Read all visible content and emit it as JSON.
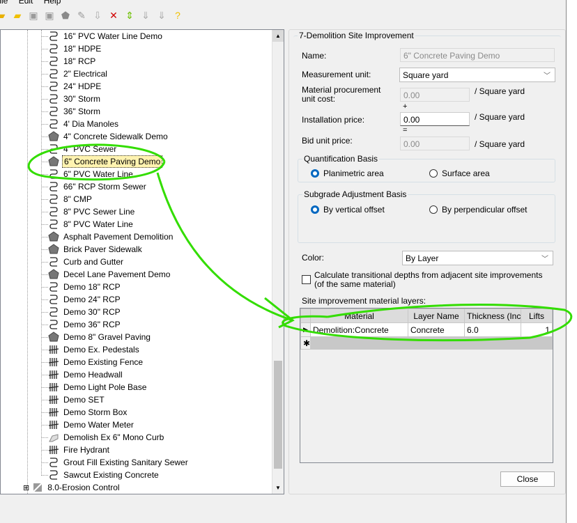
{
  "menu": [
    "File",
    "Edit",
    "Help"
  ],
  "toolbar": [
    {
      "icon": "new-folder-icon",
      "glyph": "▰",
      "color": "#e8b000"
    },
    {
      "icon": "open-folder-icon",
      "glyph": "▰",
      "color": "#f0c000"
    },
    {
      "icon": "save-icon",
      "glyph": "▣",
      "color": "#9a9a9a"
    },
    {
      "icon": "save-all-icon",
      "glyph": "▣",
      "color": "#9a9a9a"
    },
    {
      "icon": "add-shape-icon",
      "glyph": "⬟",
      "color": "#8a8a8a"
    },
    {
      "icon": "add-line-icon",
      "glyph": "✎",
      "color": "#9a9a9a"
    },
    {
      "icon": "import-icon",
      "glyph": "⇩",
      "color": "#aaa"
    },
    {
      "icon": "delete-icon",
      "glyph": "✕",
      "color": "#d00000"
    },
    {
      "icon": "expand-icon",
      "glyph": "⇕",
      "color": "#6cc000"
    },
    {
      "icon": "move-down-icon",
      "glyph": "⇓",
      "color": "#aaa"
    },
    {
      "icon": "move-down-2-icon",
      "glyph": "⇓",
      "color": "#aaa"
    },
    {
      "icon": "help-icon",
      "glyph": "?",
      "color": "#f0c000"
    }
  ],
  "tree": {
    "items": [
      {
        "label": "16\" PVC Water Line Demo",
        "icon": "pipe"
      },
      {
        "label": "18\" HDPE",
        "icon": "pipe"
      },
      {
        "label": "18\" RCP",
        "icon": "pipe"
      },
      {
        "label": "2\" Electrical",
        "icon": "pipe"
      },
      {
        "label": "24\" HDPE",
        "icon": "pipe"
      },
      {
        "label": "30\" Storm",
        "icon": "pipe"
      },
      {
        "label": "36\" Storm",
        "icon": "pipe"
      },
      {
        "label": "4' Dia Manoles",
        "icon": "pipe"
      },
      {
        "label": "4\" Concrete Sidewalk Demo",
        "icon": "area"
      },
      {
        "label": "4\" PVC Sewer",
        "icon": "pipe"
      },
      {
        "label": "6\" Concrete Paving Demo",
        "icon": "area",
        "selected": true
      },
      {
        "label": "6\" PVC Water Line",
        "icon": "pipe"
      },
      {
        "label": "66\" RCP Storm Sewer",
        "icon": "pipe"
      },
      {
        "label": "8\" CMP",
        "icon": "pipe"
      },
      {
        "label": "8\" PVC Sewer Line",
        "icon": "pipe"
      },
      {
        "label": "8\" PVC Water Line",
        "icon": "pipe"
      },
      {
        "label": "Asphalt Pavement Demolition",
        "icon": "area"
      },
      {
        "label": "Brick Paver Sidewalk",
        "icon": "area"
      },
      {
        "label": "Curb and Gutter",
        "icon": "pipe"
      },
      {
        "label": "Decel Lane Pavement Demo",
        "icon": "area"
      },
      {
        "label": "Demo 18\" RCP",
        "icon": "pipe"
      },
      {
        "label": "Demo 24\" RCP",
        "icon": "pipe"
      },
      {
        "label": "Demo 30\" RCP",
        "icon": "pipe"
      },
      {
        "label": "Demo 36\" RCP",
        "icon": "pipe"
      },
      {
        "label": "Demo 8\" Gravel Paving",
        "icon": "area"
      },
      {
        "label": "Demo Ex. Pedestals",
        "icon": "point"
      },
      {
        "label": "Demo Existing Fence",
        "icon": "point"
      },
      {
        "label": "Demo Headwall",
        "icon": "point"
      },
      {
        "label": "Demo Light Pole Base",
        "icon": "point"
      },
      {
        "label": "Demo SET",
        "icon": "point"
      },
      {
        "label": "Demo Storm Box",
        "icon": "point"
      },
      {
        "label": "Demo Water Meter",
        "icon": "point"
      },
      {
        "label": "Demolish Ex 6\" Mono Curb",
        "icon": "curb"
      },
      {
        "label": "Fire Hydrant",
        "icon": "point"
      },
      {
        "label": "Grout Fill Existing Sanitary Sewer",
        "icon": "pipe"
      },
      {
        "label": "Sawcut Existing Concrete",
        "icon": "pipe"
      }
    ],
    "folder": {
      "label": "8.0-Erosion Control",
      "expander": "⊞"
    }
  },
  "panel": {
    "title": "7-Demolition Site Improvement",
    "name_label": "Name:",
    "name_value": "6\" Concrete Paving Demo",
    "unit_label": "Measurement unit:",
    "unit_value": "Square yard",
    "mat_cost_label": "Material procurement unit cost:",
    "mat_cost_value": "0.00",
    "per_unit": "/ Square yard",
    "plus": "+",
    "install_label": "Installation price:",
    "install_value": "0.00",
    "equals": "=",
    "bid_label": "Bid unit price:",
    "bid_value": "0.00",
    "quant_title": "Quantification Basis",
    "quant_opt1": "Planimetric area",
    "quant_opt2": "Surface area",
    "subgrade_title": "Subgrade Adjustment Basis",
    "sub_opt1": "By vertical offset",
    "sub_opt2": "By perpendicular offset",
    "color_label": "Color:",
    "color_value": "By Layer",
    "calc_label": "Calculate transitional depths from adjacent site improvements (of the same material)",
    "layers_label": "Site improvement material layers:",
    "columns": [
      "Material",
      "Layer Name",
      "Thickness (Inch",
      "Lifts"
    ],
    "rows": [
      {
        "material": "Demolition:Concrete",
        "layer": "Concrete",
        "thickness": "6.0",
        "lifts": "1"
      }
    ],
    "close": "Close"
  },
  "annotation_color": "#33dd00"
}
